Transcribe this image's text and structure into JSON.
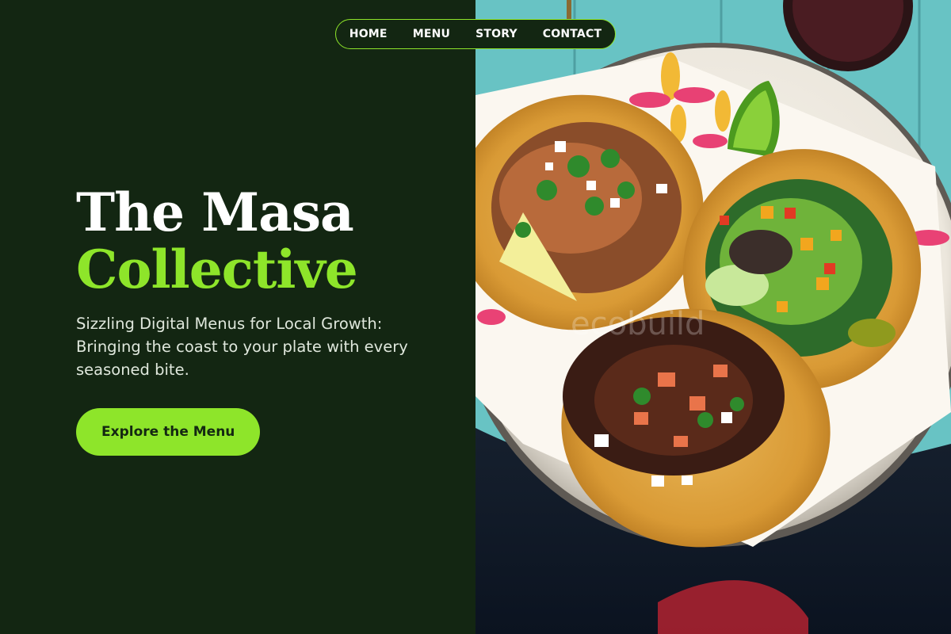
{
  "nav": {
    "items": [
      {
        "label": "HOME"
      },
      {
        "label": "MENU"
      },
      {
        "label": "STORY"
      },
      {
        "label": "CONTACT"
      }
    ]
  },
  "hero": {
    "title_line_1": "The Masa",
    "title_line_2": "Collective",
    "subtitle": "Sizzling Digital Menus for Local Growth: Bringing the coast to your plate with every seasoned bite.",
    "cta_label": "Explore the Menu"
  },
  "hero_image": {
    "alt": "Three tacos on a plate",
    "watermark": "ecobuild"
  },
  "colors": {
    "background": "#132612",
    "accent": "#8ee52a",
    "text_primary": "#ffffff",
    "text_secondary": "#dfe7dc",
    "button_text": "#142812",
    "table_teal": "#6cc7c9"
  }
}
